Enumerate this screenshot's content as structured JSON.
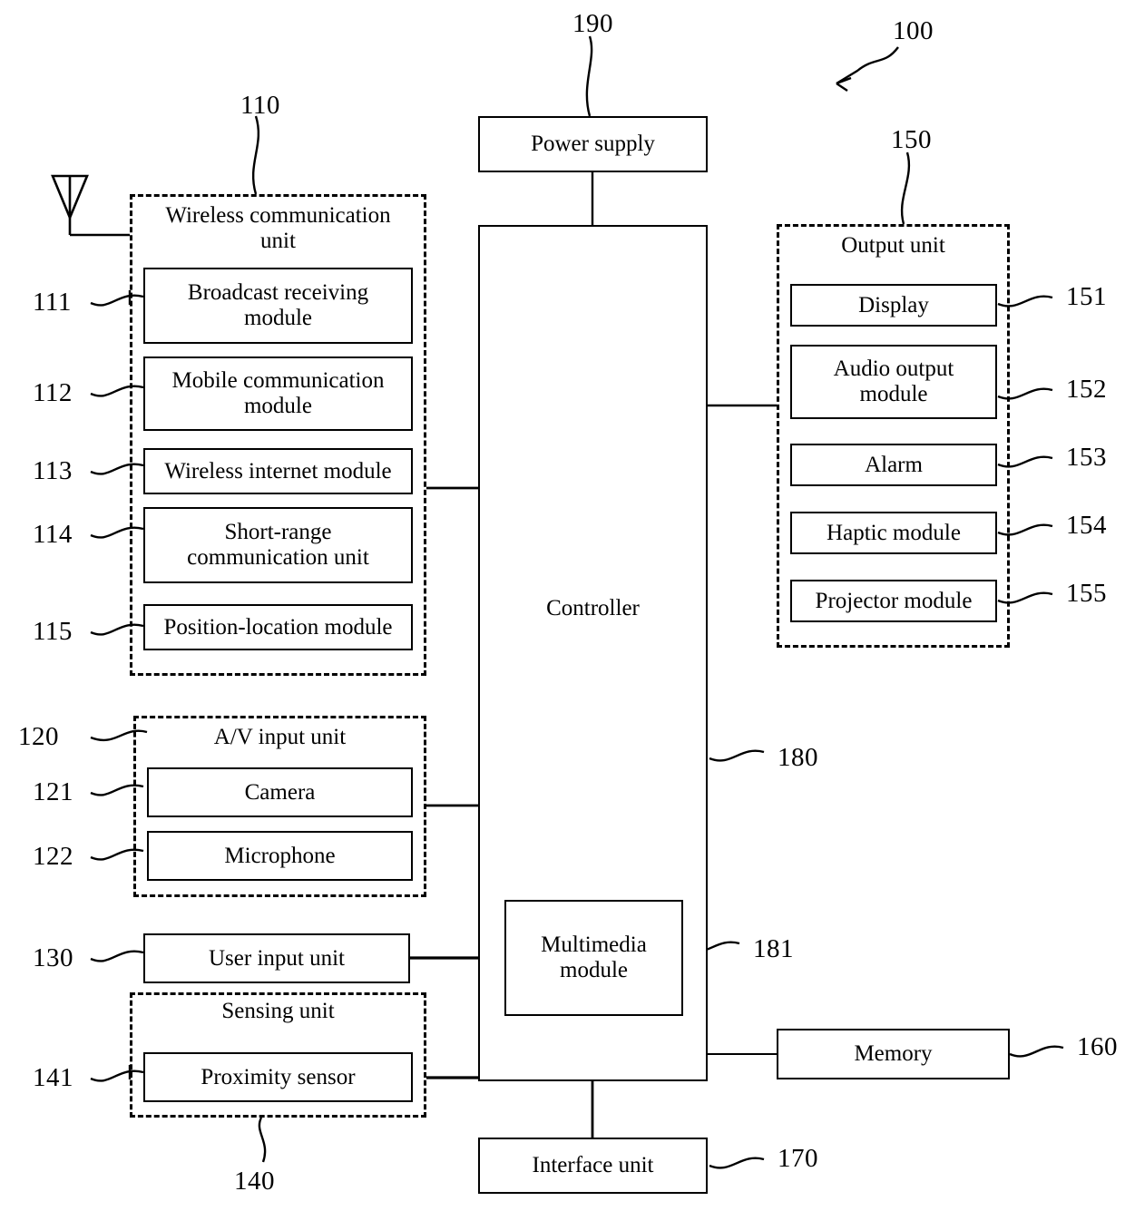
{
  "figure": {
    "type": "patent-block-diagram",
    "device_reference": "100"
  },
  "blocks": {
    "power_supply": {
      "label": "Power supply",
      "ref": "190"
    },
    "controller": {
      "label": "Controller",
      "ref": "180"
    },
    "multimedia_module": {
      "label": "Multimedia\nmodule",
      "ref": "181"
    },
    "memory": {
      "label": "Memory",
      "ref": "160"
    },
    "interface_unit": {
      "label": "Interface unit",
      "ref": "170"
    },
    "user_input_unit": {
      "label": "User input unit",
      "ref": "130"
    }
  },
  "wireless_communication_unit": {
    "title": "Wireless communication\nunit",
    "ref": "110",
    "modules": [
      {
        "label": "Broadcast receiving\nmodule",
        "ref": "111"
      },
      {
        "label": "Mobile communication\nmodule",
        "ref": "112"
      },
      {
        "label": "Wireless internet module",
        "ref": "113"
      },
      {
        "label": "Short-range\ncommunication unit",
        "ref": "114"
      },
      {
        "label": "Position-location module",
        "ref": "115"
      }
    ]
  },
  "av_input_unit": {
    "title": "A/V input unit",
    "ref": "120",
    "modules": [
      {
        "label": "Camera",
        "ref": "121"
      },
      {
        "label": "Microphone",
        "ref": "122"
      }
    ]
  },
  "sensing_unit": {
    "title": "Sensing unit",
    "ref": "140",
    "modules": [
      {
        "label": "Proximity sensor",
        "ref": "141"
      }
    ]
  },
  "output_unit": {
    "title": "Output unit",
    "ref": "150",
    "modules": [
      {
        "label": "Display",
        "ref": "151"
      },
      {
        "label": "Audio output\nmodule",
        "ref": "152"
      },
      {
        "label": "Alarm",
        "ref": "153"
      },
      {
        "label": "Haptic module",
        "ref": "154"
      },
      {
        "label": "Projector module",
        "ref": "155"
      }
    ]
  },
  "icons": {
    "antenna": "antenna-icon"
  }
}
